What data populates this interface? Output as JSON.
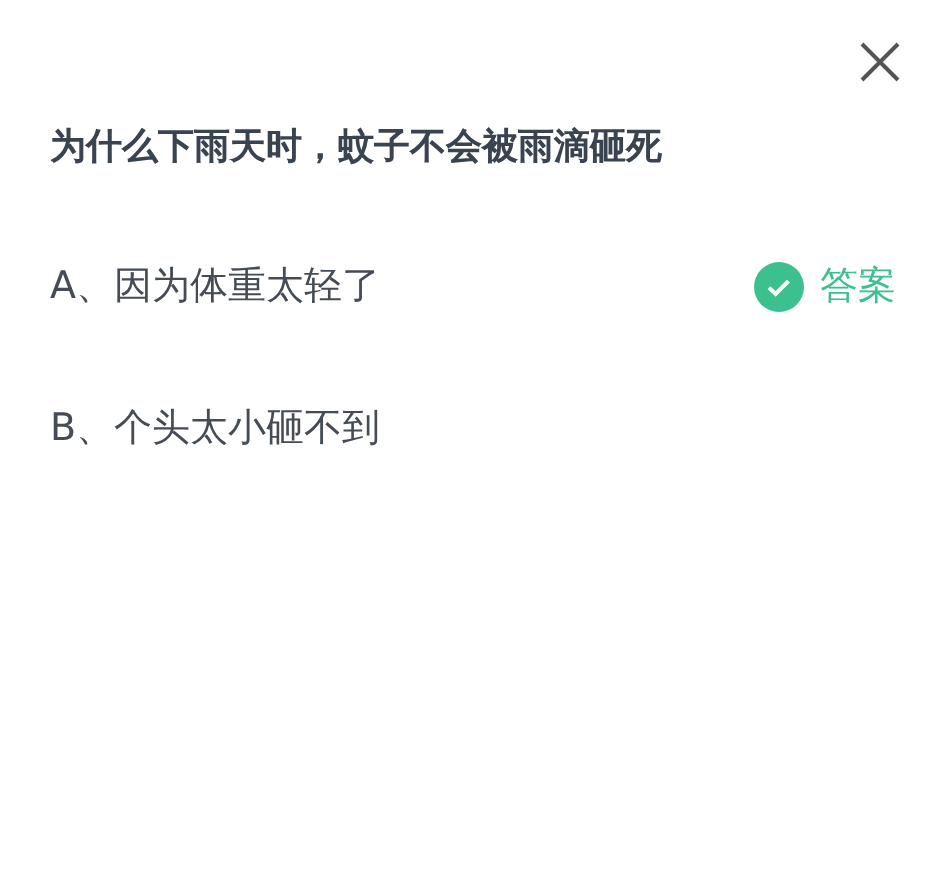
{
  "question": "为什么下雨天时，蚊子不会被雨滴砸死",
  "options": [
    {
      "text": "A、因为体重太轻了",
      "answer": true,
      "answer_label": "答案"
    },
    {
      "text": "B、个头太小砸不到",
      "answer": false
    }
  ]
}
